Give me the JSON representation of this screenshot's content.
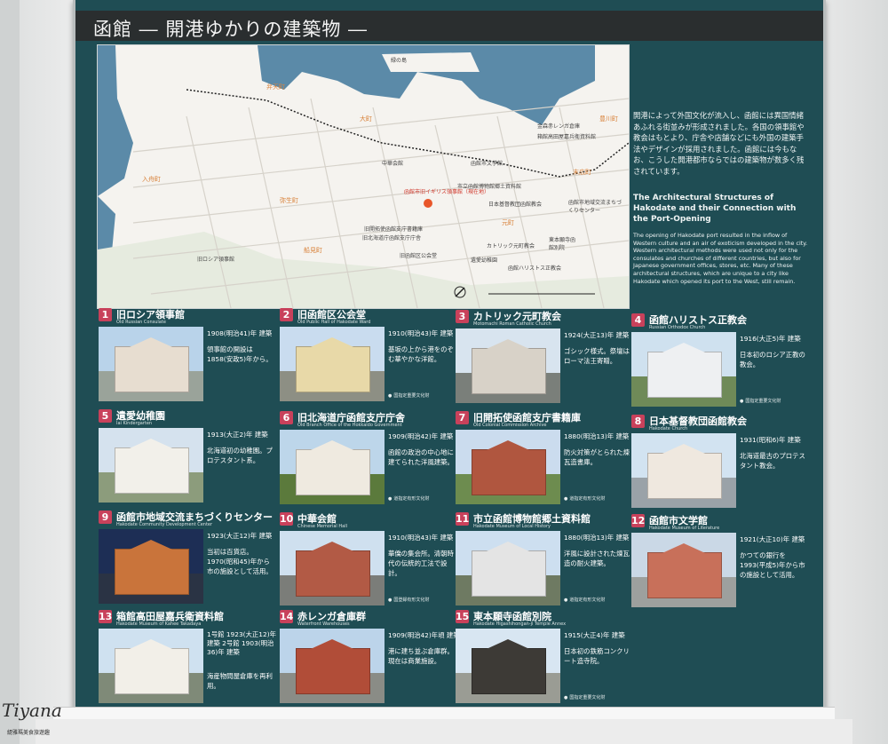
{
  "title": "函館 ― 開港ゆかりの建築物 ―",
  "map": {
    "labels": {
      "island": "緑の島",
      "benten": "弁天町",
      "ohmachi": "大町",
      "irifune": "入舟町",
      "yayoi": "弥生町",
      "funami": "船見町",
      "motomachi": "元町",
      "suehiro": "末広町",
      "toyokawa": "豊川町"
    },
    "british": "函館市旧イギリス領事館（現在地）",
    "places": [
      "金森赤レンガ倉庫",
      "箱館高田屋嘉兵衛資料館",
      "函館市文学館",
      "市立函館博物館郷土資料館",
      "日本基督教団函館教会",
      "函館市地域交流まちづくりセンター",
      "中華会館",
      "旧開拓使函館支庁書籍庫",
      "旧北海道庁函館支庁庁舎",
      "カトリック元町教会",
      "東本願寺函館別院",
      "旧函館区公会堂",
      "遺愛幼稚園",
      "函館ハリストス正教会",
      "旧ロシア領事館"
    ]
  },
  "intro": {
    "jp": "開港によって外国文化が流入し、函館には異国情緒あふれる街並みが形成されました。各国の領事館や教会はもとより、庁舎や店舗などにも外国の建築手法やデザインが採用されました。函館には今もなお、こうした開港都市ならではの建築物が数多く残されています。",
    "en_title": "The Architectural Structures of Hakodate and their Connection with the Port-Opening",
    "en": "The opening of Hakodate port resulted in the inflow of Western culture and an air of exoticism developed in the city. Western architectural methods were used not only for the consulates and churches of different countries, but also for Japanese government offices, stores, etc. Many of these architectural structures, which are unique to a city like Hakodate which opened its port to the West, still remain."
  },
  "cards": [
    {
      "num": "1",
      "name": "旧ロシア領事館",
      "sub": "Old Russian Consulate",
      "year": "1908(明治41)年 建築",
      "desc": "領事館の開設は1858(安政5)年から。",
      "badge": ""
    },
    {
      "num": "2",
      "name": "旧函館区公会堂",
      "sub": "Old Public Hall of Hakodate Ward",
      "year": "1910(明治43)年 建築",
      "desc": "基坂の上から港をのぞむ華やかな洋館。",
      "badge": "国指定重要文化財"
    },
    {
      "num": "3",
      "name": "カトリック元町教会",
      "sub": "Motomachi Roman Catholic Church",
      "year": "1924(大正13)年 建築",
      "desc": "ゴシック様式。祭壇はローマ法王寄贈。",
      "badge": ""
    },
    {
      "num": "4",
      "name": "函館ハリストス正教会",
      "sub": "Russian Orthodox Church",
      "year": "1916(大正5)年 建築",
      "desc": "日本初のロシア正教の教会。",
      "badge": "国指定重要文化財"
    },
    {
      "num": "5",
      "name": "遺愛幼稚園",
      "sub": "Iai Kindergarten",
      "year": "1913(大正2)年 建築",
      "desc": "北海道初の幼稚園。プロテスタント系。",
      "badge": ""
    },
    {
      "num": "6",
      "name": "旧北海道庁函館支庁庁舎",
      "sub": "Old Branch Office of the Hokkaido Government",
      "year": "1909(明治42)年 建築",
      "desc": "函館の政治の中心地に建てられた洋風建築。",
      "badge": "道指定有形文化財"
    },
    {
      "num": "7",
      "name": "旧開拓使函館支庁書籍庫",
      "sub": "Old Colonial Commission Archive",
      "year": "1880(明治13)年 建築",
      "desc": "防火対策がとられた煉瓦造書庫。",
      "badge": "道指定有形文化財"
    },
    {
      "num": "8",
      "name": "日本基督教団函館教会",
      "sub": "Hakodate Church",
      "year": "1931(昭和6)年 建築",
      "desc": "北海道最古のプロテスタント教会。",
      "badge": ""
    },
    {
      "num": "9",
      "name": "函館市地域交流まちづくりセンター",
      "sub": "Hakodate Community Development Center",
      "year": "1923(大正12)年 建築",
      "desc": "当初は百貨店。1970(昭和45)年から市の施設として活用。",
      "badge": ""
    },
    {
      "num": "10",
      "name": "中華会館",
      "sub": "Chinese Memorial Hall",
      "year": "1910(明治43)年 建築",
      "desc": "華僑の集会所。清朝時代の伝統的工法で設計。",
      "badge": "国登録有形文化財"
    },
    {
      "num": "11",
      "name": "市立函館博物館郷土資料館",
      "sub": "Hakodate Museum of Local History",
      "year": "1880(明治13)年 建築",
      "desc": "洋風に設計された煉瓦造の耐火建築。",
      "badge": "道指定有形文化財"
    },
    {
      "num": "12",
      "name": "函館市文学館",
      "sub": "Hakodate Museum of Literature",
      "year": "1921(大正10)年 建築",
      "desc": "かつての銀行を1993(平成5)年から市の施設として活用。",
      "badge": ""
    },
    {
      "num": "13",
      "name": "箱館高田屋嘉兵衛資料館",
      "sub": "Hakodate Museum of Kahee Takadaya",
      "year": "1号館 1923(大正12)年 建築 2号館 1903(明治36)年 建築",
      "desc": "海産物問屋倉庫を再利用。",
      "badge": ""
    },
    {
      "num": "14",
      "name": "赤レンガ倉庫群",
      "sub": "Waterfront Warehouses",
      "year": "1909(明治42)年頃 建築",
      "desc": "港に建ち並ぶ倉庫群。現在は商業施設。",
      "badge": ""
    },
    {
      "num": "15",
      "name": "東本願寺函館別院",
      "sub": "Hakodate Higashihongan-ji Temple Annex",
      "year": "1915(大正4)年 建築",
      "desc": "日本初の鉄筋コンクリート造寺院。",
      "badge": "国指定重要文化財"
    }
  ],
  "watermark": {
    "logo": "Tiyana",
    "caption": "緹雅瑪美食旅遊趣"
  },
  "colors": {
    "board": "#1f4d54",
    "number_badge": "#c8415b",
    "title_bar": "#2a2e2f",
    "sea": "#5b8aa8"
  }
}
